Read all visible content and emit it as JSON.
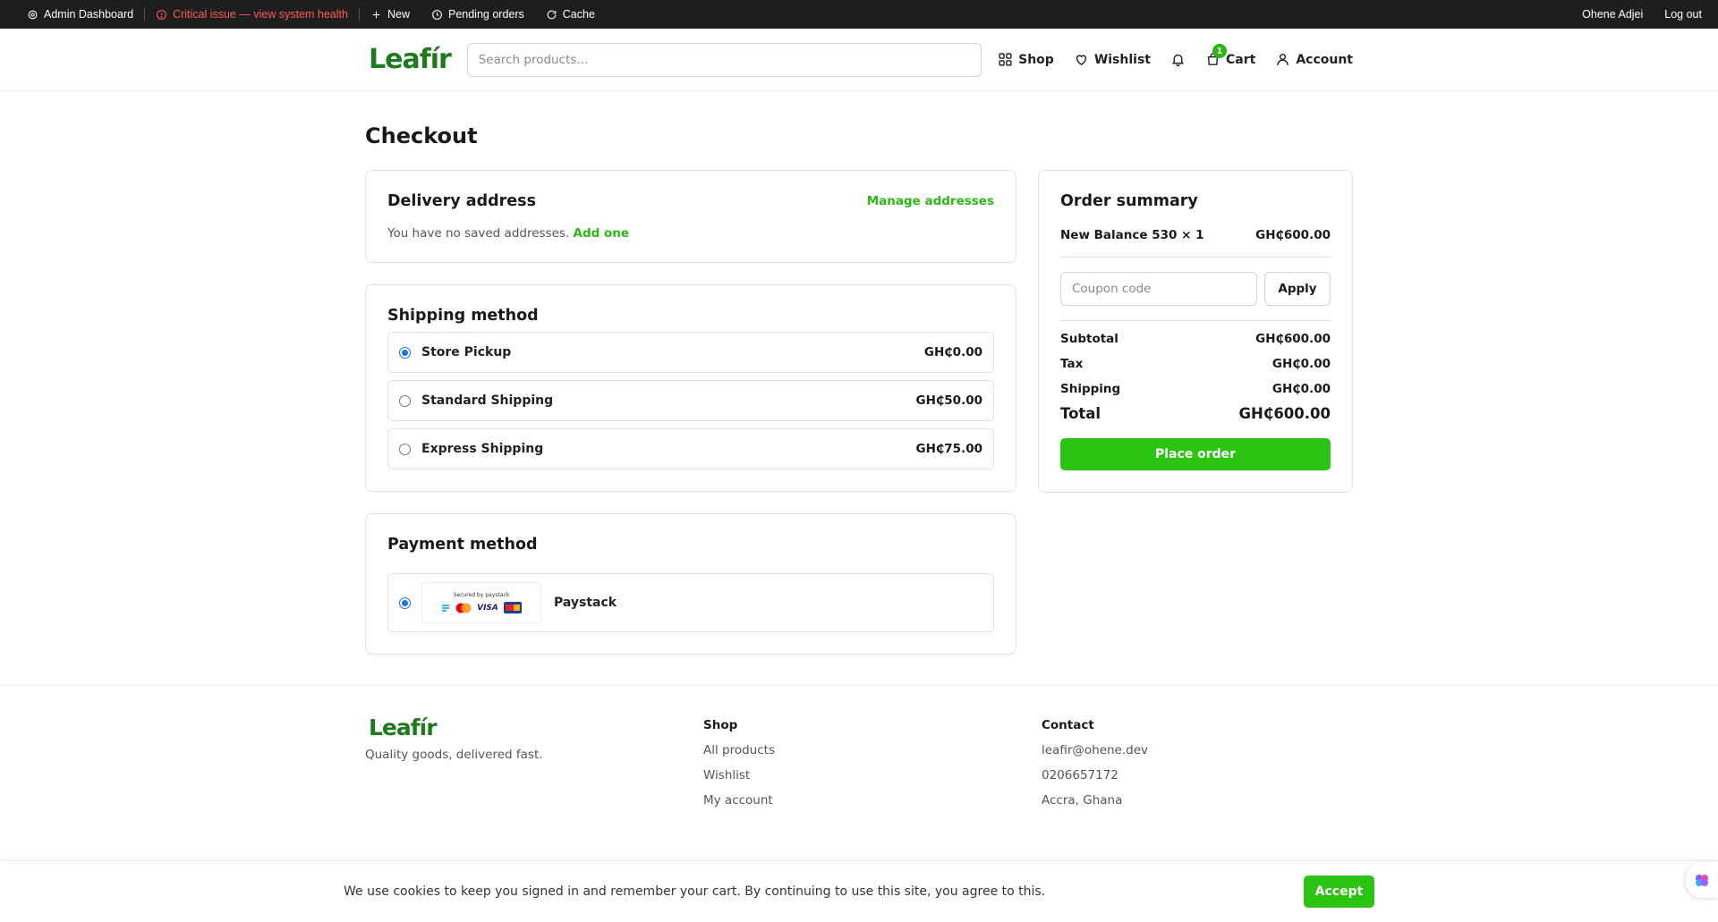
{
  "admin_bar": {
    "dashboard": "Admin Dashboard",
    "critical": "Critical issue — view system health",
    "new": "New",
    "pending": "Pending orders",
    "cache": "Cache",
    "user": "Ohene Adjei",
    "logout": "Log out"
  },
  "header": {
    "logo": "Leafír",
    "search_placeholder": "Search products...",
    "nav": {
      "shop": "Shop",
      "wishlist": "Wishlist",
      "cart": "Cart",
      "cart_count": "1",
      "account": "Account"
    }
  },
  "page": {
    "title": "Checkout"
  },
  "delivery": {
    "title": "Delivery address",
    "manage": "Manage addresses",
    "empty_text": "You have no saved addresses.",
    "add_one": "Add one"
  },
  "shipping": {
    "title": "Shipping method",
    "options": [
      {
        "label": "Store Pickup",
        "price": "GH₵0.00",
        "selected": true
      },
      {
        "label": "Standard Shipping",
        "price": "GH₵50.00",
        "selected": false
      },
      {
        "label": "Express Shipping",
        "price": "GH₵75.00",
        "selected": false
      }
    ]
  },
  "payment": {
    "title": "Payment method",
    "secured_by": "Secured by paystack",
    "visa": "VISA",
    "option": "Paystack"
  },
  "summary": {
    "title": "Order summary",
    "item_name": "New Balance 530 × 1",
    "item_price": "GH₵600.00",
    "coupon_placeholder": "Coupon code",
    "apply": "Apply",
    "subtotal_label": "Subtotal",
    "subtotal": "GH₵600.00",
    "tax_label": "Tax",
    "tax": "GH₵0.00",
    "shipping_label": "Shipping",
    "shipping": "GH₵0.00",
    "total_label": "Total",
    "total": "GH₵600.00",
    "place_order": "Place order"
  },
  "footer": {
    "logo": "Leafír",
    "tagline": "Quality goods, delivered fast.",
    "shop_heading": "Shop",
    "shop_links": [
      "All products",
      "Wishlist",
      "My account"
    ],
    "contact_heading": "Contact",
    "contact_lines": [
      "leafir@ohene.dev",
      "0206657172",
      "Accra, Ghana"
    ]
  },
  "cookie": {
    "text": "We use cookies to keep you signed in and remember your cart. By continuing to use this site, you agree to this.",
    "accept": "Accept"
  },
  "colors": {
    "brand_green": "#1d7a1d",
    "accent_green": "#2bc413",
    "critical_red": "#ff5a5a",
    "radio_blue": "#1a73e8"
  }
}
